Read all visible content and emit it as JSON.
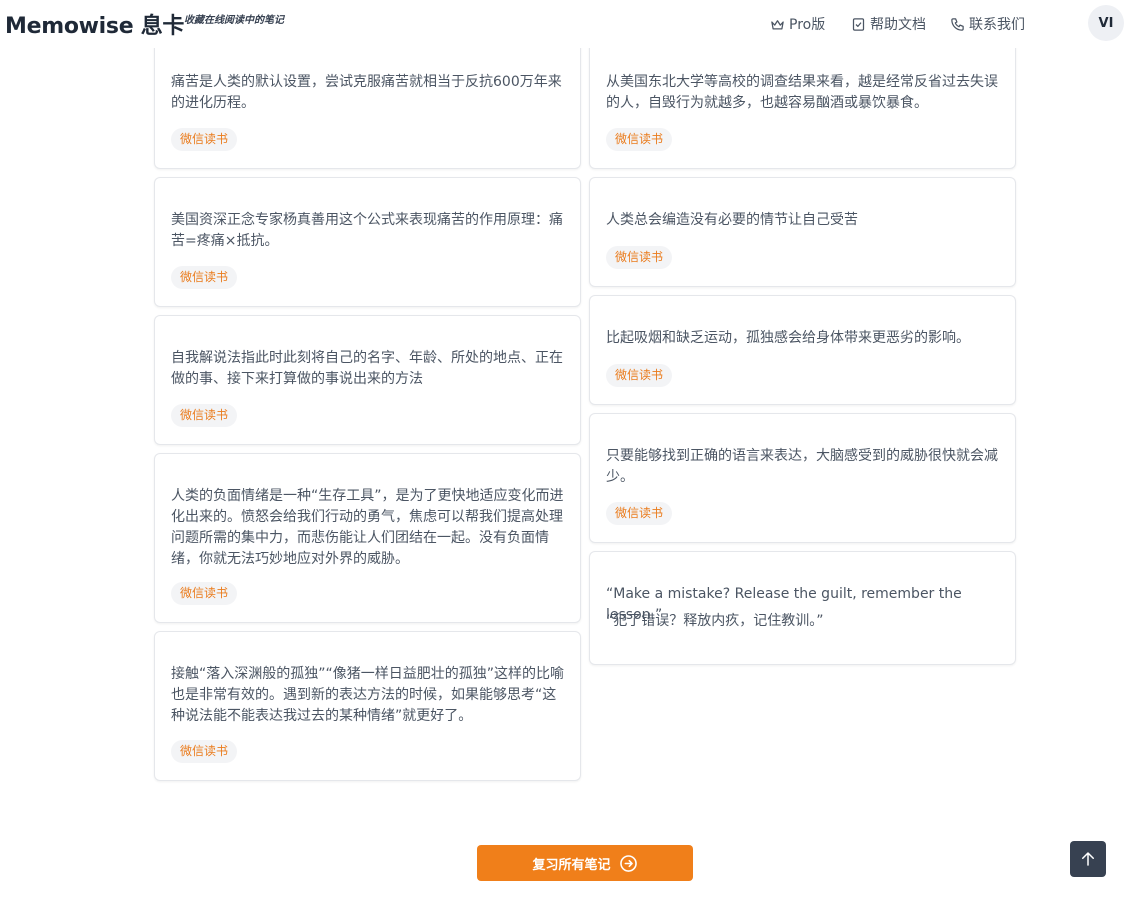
{
  "header": {
    "logo": "Memowise 息卡",
    "slogan": "收藏在线阅读中的笔记",
    "nav": {
      "pro": "Pro版",
      "help": "帮助文档",
      "contact": "联系我们"
    },
    "avatar": "VI"
  },
  "notes": [
    {
      "text": "痛苦是人类的默认设置，尝试克服痛苦就相当于反抗600万年来的进化历程。",
      "tag": "微信读书"
    },
    {
      "text": "从美国东北大学等高校的调查结果来看，越是经常反省过去失误的人，自毁行为就越多，也越容易酗酒或暴饮暴食。",
      "tag": "微信读书"
    },
    {
      "text": "美国资深正念专家杨真善用这个公式来表现痛苦的作用原理：痛苦=疼痛×抵抗。",
      "tag": "微信读书"
    },
    {
      "text": "人类总会编造没有必要的情节让自己受苦",
      "tag": "微信读书"
    },
    {
      "text": "自我解说法指此时此刻将自己的名字、年龄、所处的地点、正在做的事、接下来打算做的事说出来的方法",
      "tag": "微信读书"
    },
    {
      "text": "比起吸烟和缺乏运动，孤独感会给身体带来更恶劣的影响。",
      "tag": "微信读书"
    },
    {
      "text": "人类的负面情绪是一种“生存工具”，是为了更快地适应变化而进化出来的。愤怒会给我们行动的勇气，焦虑可以帮我们提高处理问题所需的集中力，而悲伤能让人们团结在一起。没有负面情绪，你就无法巧妙地应对外界的威胁。",
      "tag": "微信读书"
    },
    {
      "text": "只要能够找到正确的语言来表达，大脑感受到的威胁很快就会减少。",
      "tag": "微信读书"
    },
    {
      "text": "接触“落入深渊般的孤独”“像猪一样日益肥壮的孤独”这样的比喻也是非常有效的。遇到新的表达方法的时候，如果能够思考“这种说法能不能表达我过去的某种情绪”就更好了。",
      "tag": "微信读书"
    },
    {
      "text": "“Make a mistake? Release the guilt, remember the lesson.”",
      "text2": "“犯了错误？释放内疚，记住教训。”"
    }
  ],
  "review_button": "复习所有笔记",
  "accent_color": "#f07f1a",
  "tag_color": "#ea7b1c",
  "icons": [
    "crown-icon",
    "check-square-icon",
    "phone-icon",
    "arrow-right-circle-icon",
    "arrow-up-icon"
  ]
}
